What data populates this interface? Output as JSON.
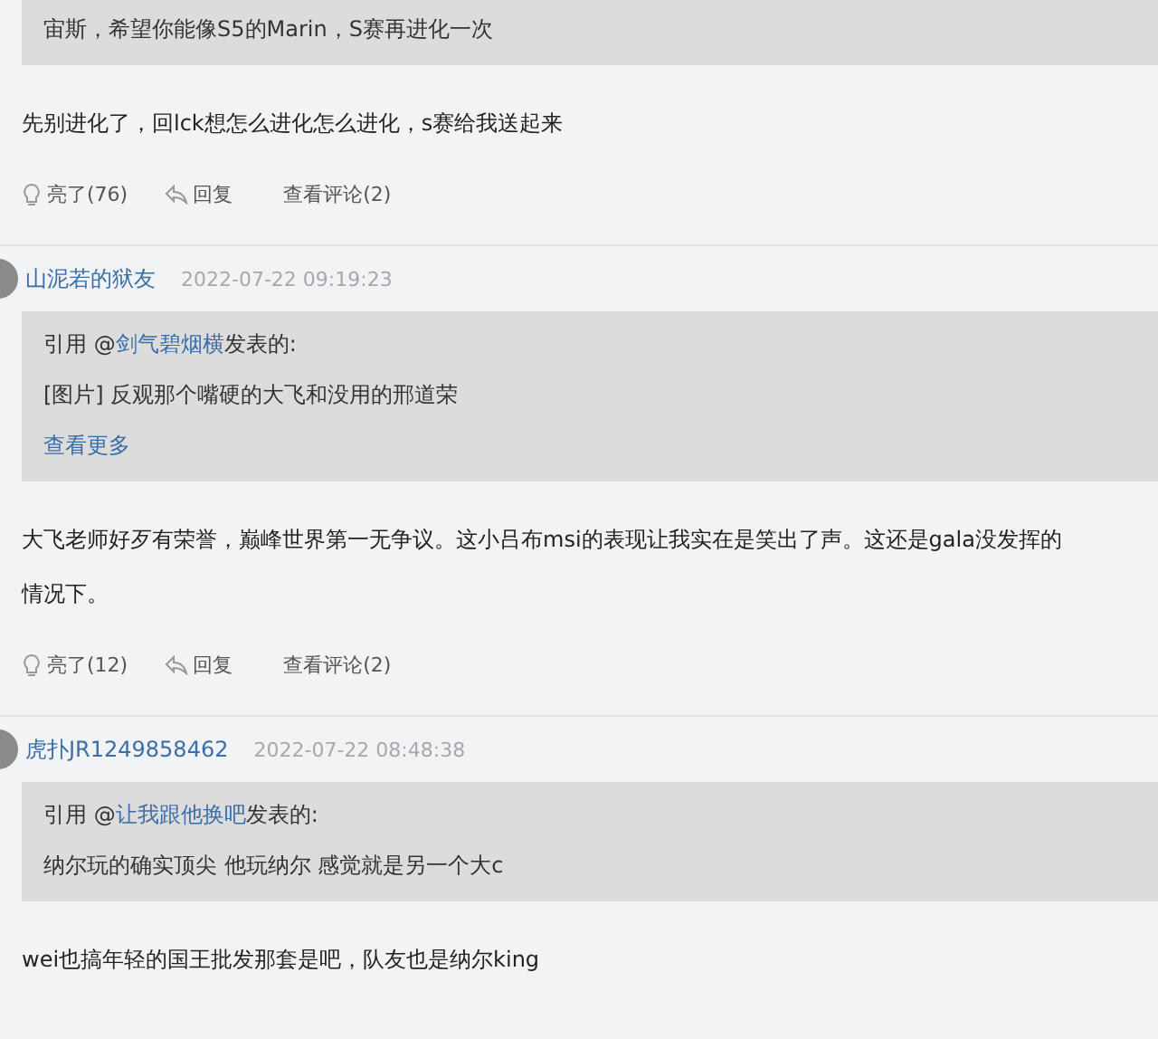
{
  "posts": [
    {
      "quote": {
        "text": "宙斯，希望你能像S5的Marin，S赛再进化一次"
      },
      "body": [
        "先别进化了，回lck想怎么进化怎么进化，s赛给我送起来"
      ],
      "actions": {
        "likes": "亮了(76)",
        "reply": "回复",
        "comments": "查看评论(2)"
      }
    },
    {
      "user": "山泥若的狱友",
      "time": "2022-07-22 09:19:23",
      "quote": {
        "prefix": "引用 @",
        "author": "剑气碧烟横",
        "suffix": "发表的:",
        "text": "[图片] 反观那个嘴硬的大飞和没用的邢道荣",
        "more": "查看更多"
      },
      "body": [
        "大飞老师好歹有荣誉，巅峰世界第一无争议。这小吕布msi的表现让我实在是笑出了声。这还是gala没发挥的",
        "情况下。"
      ],
      "actions": {
        "likes": "亮了(12)",
        "reply": "回复",
        "comments": "查看评论(2)"
      }
    },
    {
      "user": "虎扑JR1249858462",
      "time": "2022-07-22 08:48:38",
      "quote": {
        "prefix": "引用 @",
        "author": "让我跟他换吧",
        "suffix": "发表的:",
        "text": "纳尔玩的确实顶尖 他玩纳尔 感觉就是另一个大c"
      },
      "body": [
        "wei也搞年轻的国王批发那套是吧，队友也是纳尔king"
      ]
    }
  ]
}
